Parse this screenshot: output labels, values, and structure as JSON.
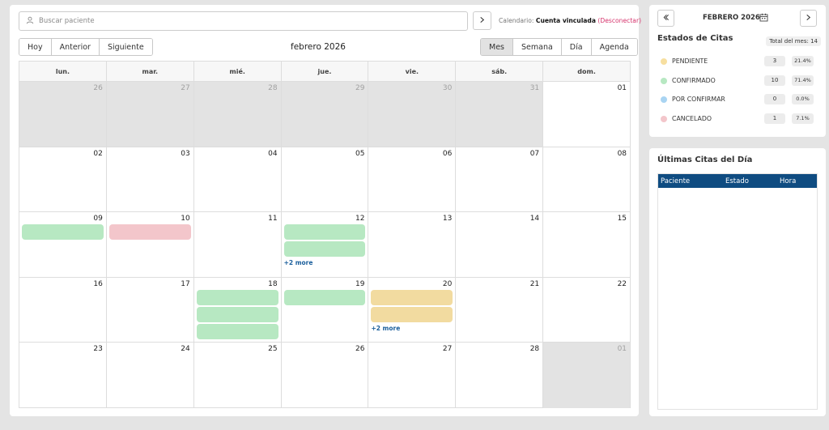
{
  "search": {
    "placeholder": "Buscar paciente"
  },
  "calendar_status": {
    "label": "Calendario:",
    "linked": "Cuenta vinculada",
    "disconnect": "(Desconectar)"
  },
  "toolbar": {
    "today": "Hoy",
    "prev": "Anterior",
    "next": "Siguiente",
    "title": "febrero 2026"
  },
  "views": {
    "month": "Mes",
    "week": "Semana",
    "day": "Día",
    "agenda": "Agenda",
    "active": "Mes"
  },
  "weekdays": [
    "lun.",
    "mar.",
    "mié.",
    "jue.",
    "vie.",
    "sáb.",
    "dom."
  ],
  "weeks": [
    [
      {
        "n": "26",
        "other": true
      },
      {
        "n": "27",
        "other": true
      },
      {
        "n": "28",
        "other": true
      },
      {
        "n": "29",
        "other": true
      },
      {
        "n": "30",
        "other": true
      },
      {
        "n": "31",
        "other": true
      },
      {
        "n": "01"
      }
    ],
    [
      {
        "n": "02"
      },
      {
        "n": "03"
      },
      {
        "n": "04"
      },
      {
        "n": "05"
      },
      {
        "n": "06"
      },
      {
        "n": "07"
      },
      {
        "n": "08"
      }
    ],
    [
      {
        "n": "09",
        "events": [
          "confirmado"
        ]
      },
      {
        "n": "10",
        "events": [
          "cancelado"
        ]
      },
      {
        "n": "11"
      },
      {
        "n": "12",
        "events": [
          "confirmado",
          "confirmado"
        ],
        "more": "+2 more"
      },
      {
        "n": "13"
      },
      {
        "n": "14"
      },
      {
        "n": "15"
      }
    ],
    [
      {
        "n": "16"
      },
      {
        "n": "17"
      },
      {
        "n": "18",
        "events": [
          "confirmado",
          "confirmado",
          "confirmado"
        ]
      },
      {
        "n": "19",
        "events": [
          "confirmado"
        ]
      },
      {
        "n": "20",
        "events": [
          "pendiente",
          "pendiente"
        ],
        "more": "+2 more"
      },
      {
        "n": "21"
      },
      {
        "n": "22"
      }
    ],
    [
      {
        "n": "23"
      },
      {
        "n": "24"
      },
      {
        "n": "25"
      },
      {
        "n": "26"
      },
      {
        "n": "27"
      },
      {
        "n": "28"
      },
      {
        "n": "01",
        "other": true
      }
    ]
  ],
  "event_colors": {
    "confirmado": "#b7e8c2",
    "cancelado": "#f3c6cb",
    "pendiente": "#f2dba0"
  },
  "mini": {
    "month": "FEBRERO 2026"
  },
  "status": {
    "title": "Estados de Citas",
    "total": "Total del mes: 14",
    "items": [
      {
        "name": "PENDIENTE",
        "count": "3",
        "pct": "21.4%",
        "color": "#f7dfa0"
      },
      {
        "name": "CONFIRMADO",
        "count": "10",
        "pct": "71.4%",
        "color": "#b7e8c2"
      },
      {
        "name": "POR CONFIRMAR",
        "count": "0",
        "pct": "0.0%",
        "color": "#a9d4f2"
      },
      {
        "name": "CANCELADO",
        "count": "1",
        "pct": "7.1%",
        "color": "#f3c6cb"
      }
    ]
  },
  "last": {
    "title": "Últimas Citas del Día",
    "columns": [
      "Paciente",
      "Estado",
      "Hora"
    ]
  }
}
